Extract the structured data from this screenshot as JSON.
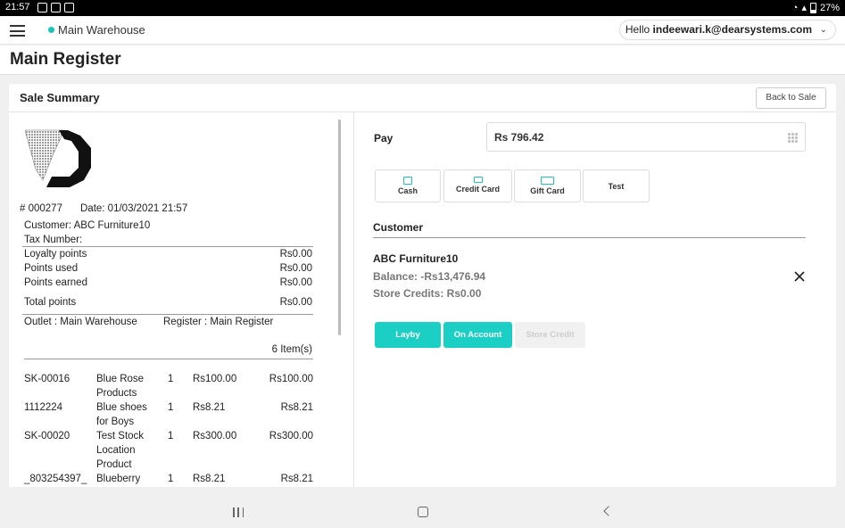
{
  "status_bar": {
    "time": "21:57",
    "battery": "27%"
  },
  "header": {
    "location": "Main Warehouse",
    "user_greeting": "Hello",
    "user_email": "indeewari.k@dearsystems.com"
  },
  "page_title": "Main Register",
  "card": {
    "title": "Sale Summary",
    "back_label": "Back to Sale"
  },
  "receipt": {
    "number": "# 000277",
    "date": "Date: 01/03/2021 21:57",
    "customer": "Customer: ABC Furniture10",
    "tax_number": "Tax Number:",
    "loyalty": [
      {
        "label": "Loyalty points",
        "value": "Rs0.00"
      },
      {
        "label": "Points used",
        "value": "Rs0.00"
      },
      {
        "label": "Points earned",
        "value": "Rs0.00"
      }
    ],
    "total_points": {
      "label": "Total points",
      "value": "Rs0.00"
    },
    "outlet": "Outlet : Main Warehouse",
    "register": "Register : Main Register",
    "item_count": "6 Item(s)",
    "items": [
      {
        "sku": "SK-00016",
        "name_lines": [
          "Blue Rose",
          "Products"
        ],
        "qty": "1",
        "price": "Rs100.00",
        "total": "Rs100.00"
      },
      {
        "sku": "1112224",
        "name_lines": [
          "Blue shoes",
          "for Boys"
        ],
        "qty": "1",
        "price": "Rs8.21",
        "total": "Rs8.21"
      },
      {
        "sku": "SK-00020",
        "name_lines": [
          "Test Stock",
          "Location",
          "Product"
        ],
        "qty": "1",
        "price": "Rs300.00",
        "total": "Rs300.00"
      },
      {
        "sku": "_803254397_",
        "name_lines": [
          "Blueberry"
        ],
        "qty": "1",
        "price": "Rs8.21",
        "total": "Rs8.21"
      }
    ]
  },
  "payment": {
    "pay_label": "Pay",
    "amount": "Rs 796.42",
    "methods": [
      "Cash",
      "Credit Card",
      "Gift Card",
      "Test"
    ],
    "customer_heading": "Customer",
    "customer_name": "ABC Furniture10",
    "balance": "Balance: -Rs13,476.94",
    "store_credits": "Store Credits: Rs0.00",
    "actions": [
      "Layby",
      "On Account",
      "Store Credit"
    ]
  },
  "colors": {
    "accent": "#1ccfc4",
    "disabled": "#f1f1f1"
  }
}
